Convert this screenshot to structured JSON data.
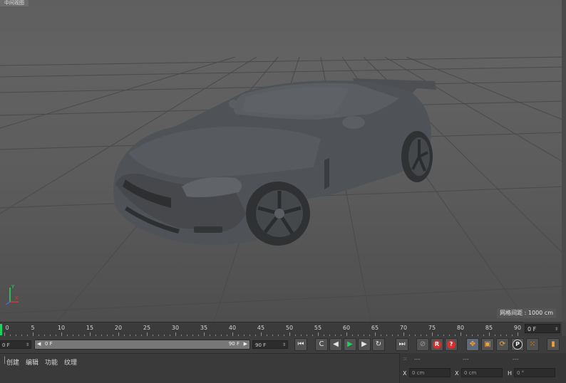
{
  "viewport": {
    "title": "中间视图",
    "grid_spacing_label": "网格间距 : 1000 cm",
    "axis_labels": [
      "Y",
      "X"
    ]
  },
  "timeline": {
    "ticks": [
      "0",
      "5",
      "10",
      "15",
      "20",
      "25",
      "30",
      "35",
      "40",
      "45",
      "50",
      "55",
      "60",
      "65",
      "70",
      "75",
      "80",
      "85",
      "90"
    ],
    "current_frame": "0 F"
  },
  "transport": {
    "start_field": "0 F",
    "range_start": "0 F",
    "range_end": "90 F",
    "end_field": "90 F",
    "buttons": {
      "goto_start": "⏮",
      "prev_key": "C",
      "step_back": "◀",
      "play": "▶",
      "step_forward": "▶",
      "next_key": "↻",
      "goto_end": "⏭",
      "record": "R",
      "auto_key": "?",
      "move": "✥",
      "scale": "▣",
      "rotate": "⟳",
      "param": "P",
      "grid": "⁙",
      "film": "▮"
    }
  },
  "menu": {
    "items": [
      "创建",
      "编辑",
      "功能",
      "纹理"
    ]
  },
  "coordinates": {
    "headers": [
      "---",
      "---",
      "---"
    ],
    "x_label": "X",
    "x_value": "0 cm",
    "x2_label": "X",
    "x2_value": "0 cm",
    "h_label": "H",
    "h_value": "0 °"
  },
  "colors": {
    "play_green": "#19d35c",
    "accent_orange": "#f2a03a",
    "record_red": "#d33030"
  }
}
